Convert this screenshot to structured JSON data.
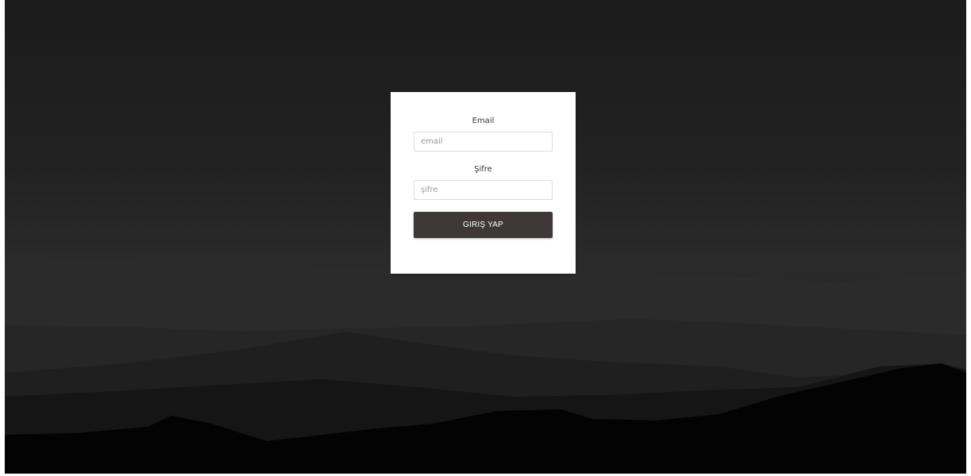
{
  "login_form": {
    "email_label": "Email",
    "email_placeholder": "email",
    "email_value": "",
    "password_label": "Şifre",
    "password_placeholder": "şifre",
    "password_value": "",
    "submit_label": "GIRIŞ YAP"
  },
  "colors": {
    "background_dark": "#1b1b1b",
    "card_background": "#ffffff",
    "button_background": "#3e3838",
    "button_text": "#ffffff"
  }
}
